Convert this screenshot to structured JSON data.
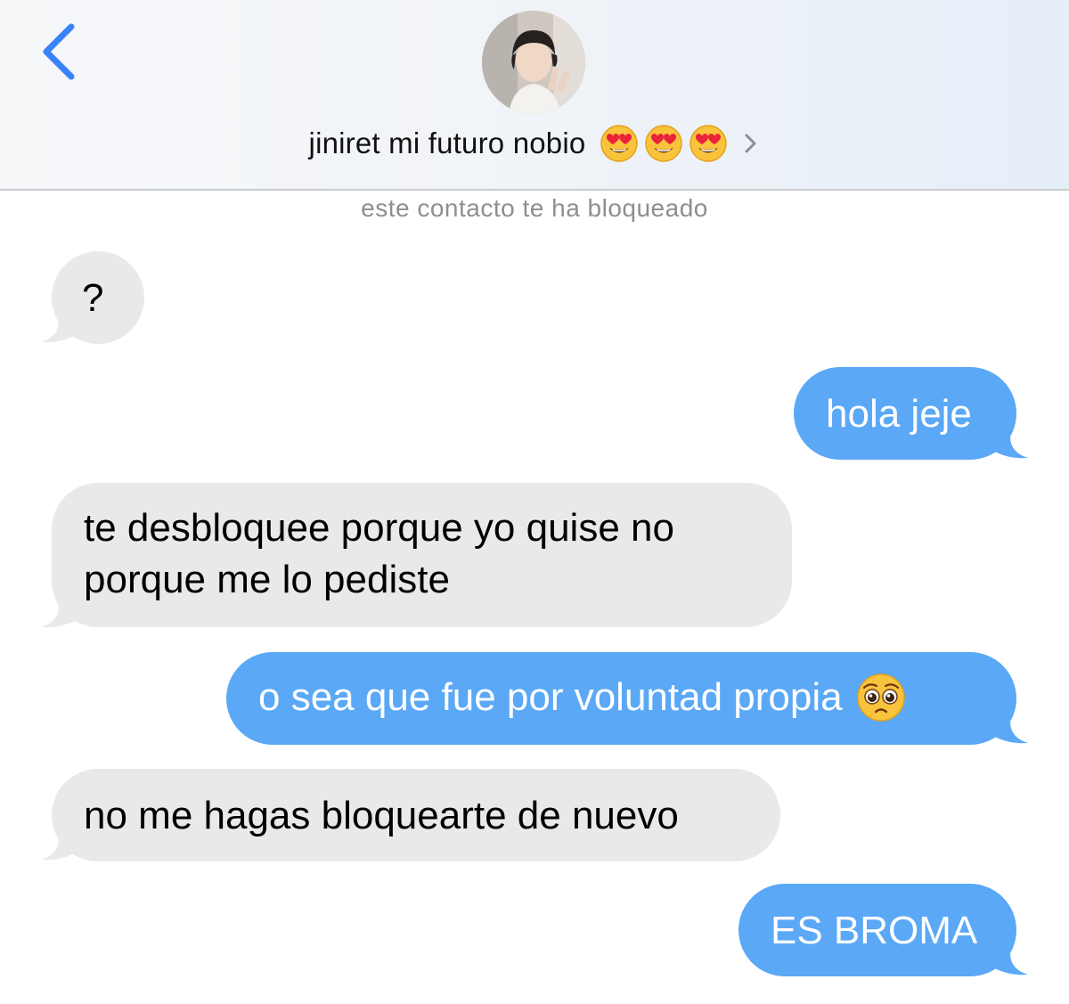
{
  "header": {
    "contact_name": "jiniret mi futuro nobio",
    "name_emojis": [
      "heart-eyes-emoji",
      "heart-eyes-emoji",
      "heart-eyes-emoji"
    ],
    "back_icon": "chevron-left-icon",
    "detail_icon": "chevron-right-icon"
  },
  "blocked_note": "este contacto te ha bloqueado",
  "messages": [
    {
      "direction": "incoming",
      "text": "?"
    },
    {
      "direction": "outgoing",
      "text": "hola jeje"
    },
    {
      "direction": "incoming",
      "line1": "te desbloquee porque yo quise no",
      "line2": "porque me lo pediste"
    },
    {
      "direction": "outgoing",
      "text": "o sea que fue por voluntad propia",
      "emoji": "pleading-face-emoji"
    },
    {
      "direction": "incoming",
      "text": "no me hagas bloquearte de nuevo"
    },
    {
      "direction": "outgoing",
      "text": "ES BROMA"
    }
  ],
  "colors": {
    "accent_blue": "#3a82f7",
    "incoming_bubble": "#e9e9eb",
    "outgoing_bubble": "#5aa8f6",
    "note_gray": "#8e8e93"
  }
}
